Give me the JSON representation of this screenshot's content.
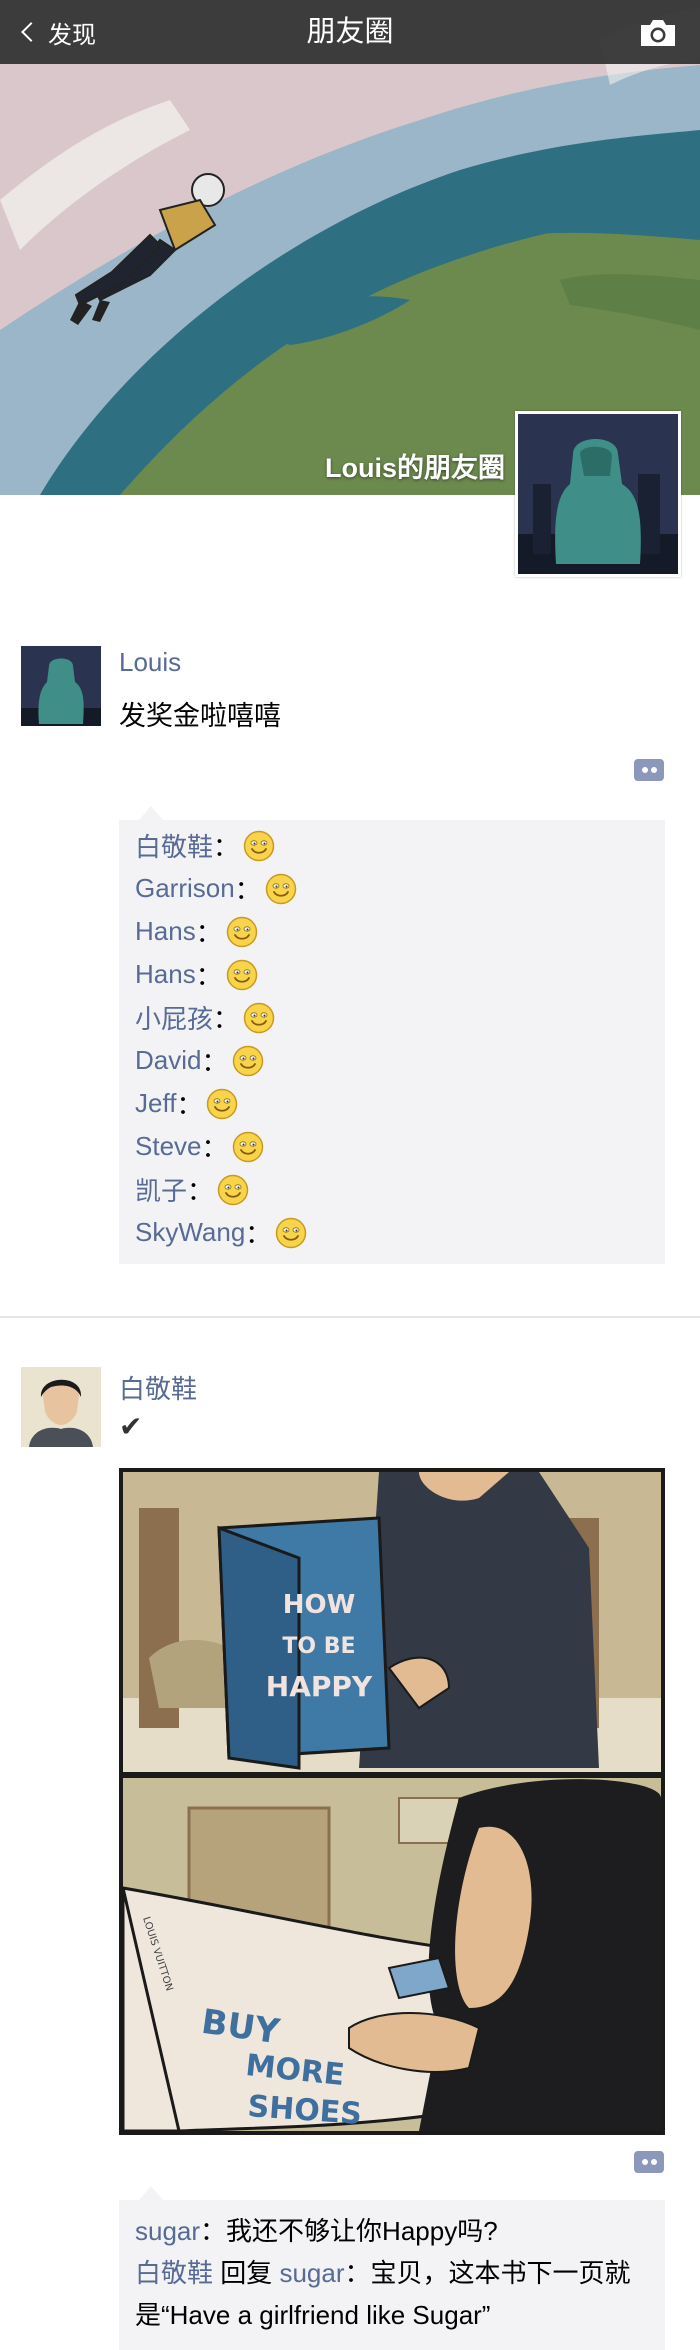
{
  "header": {
    "back_label": "发现",
    "title": "朋友圈"
  },
  "cover": {
    "name": "Louis的朋友圈"
  },
  "posts": [
    {
      "author": "Louis",
      "text": "发奖金啦嘻嘻",
      "comments": [
        {
          "name": "白敬鞋",
          "sep": "："
        },
        {
          "name": "Garrison",
          "sep": "："
        },
        {
          "name": "Hans",
          "sep": "："
        },
        {
          "name": "Hans",
          "sep": "："
        },
        {
          "name": "小屁孩",
          "sep": "："
        },
        {
          "name": "David",
          "sep": "："
        },
        {
          "name": "Jeff",
          "sep": "："
        },
        {
          "name": "Steve",
          "sep": "："
        },
        {
          "name": "凯子",
          "sep": "："
        },
        {
          "name": "SkyWang",
          "sep": "："
        }
      ]
    },
    {
      "author": "白敬鞋",
      "text": "✔",
      "image": {
        "panel1": [
          "HOW",
          "TO BE",
          "HAPPY"
        ],
        "panel2": [
          "BUY",
          "MORE",
          "SHOES"
        ],
        "spine": "LOUIS VUITTON"
      },
      "replies": {
        "r1_name": "sugar",
        "r1_text": "：我还不够让你Happy吗?",
        "r2_name": "白敬鞋",
        "r2_mid": " 回复 ",
        "r2_target": "sugar",
        "r2_line1": "：宝贝，这本书下一页就",
        "r2_line2": "是“Have a girlfriend like Sugar”"
      }
    }
  ],
  "colors": {
    "link": "#576b95",
    "comment_bg": "#f3f3f5",
    "header_bg": "#303030"
  }
}
